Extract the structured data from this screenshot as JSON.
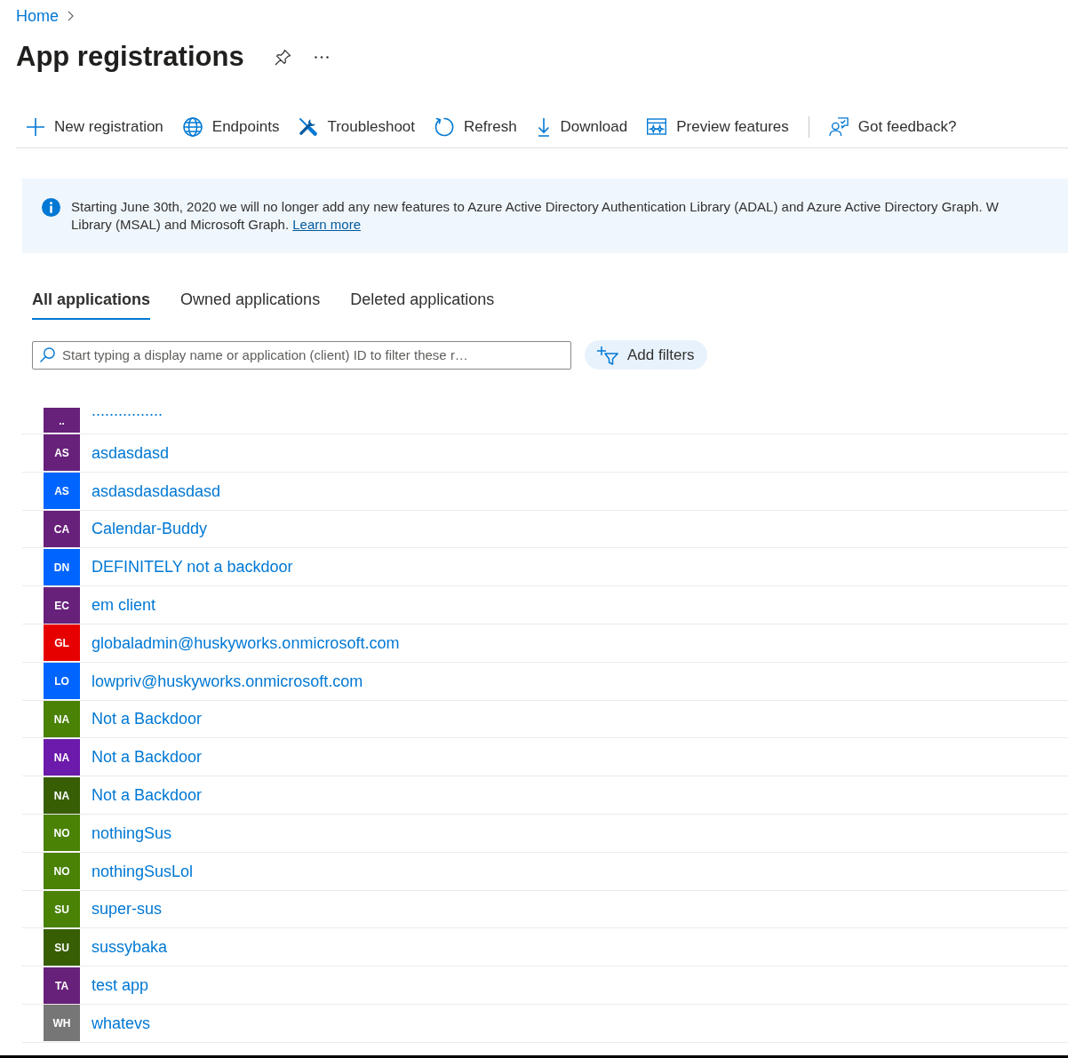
{
  "breadcrumb": [
    {
      "label": "Home"
    }
  ],
  "header": {
    "title": "App registrations"
  },
  "toolbar": [
    {
      "kind": "new",
      "label": "New registration"
    },
    {
      "kind": "endpoints",
      "label": "Endpoints"
    },
    {
      "kind": "troubleshoot",
      "label": "Troubleshoot"
    },
    {
      "kind": "refresh",
      "label": "Refresh"
    },
    {
      "kind": "download",
      "label": "Download"
    },
    {
      "kind": "preview",
      "label": "Preview features"
    },
    {
      "kind": "separator"
    },
    {
      "kind": "feedback",
      "label": "Got feedback?"
    }
  ],
  "banner": {
    "text_lines": [
      "Starting June 30th, 2020 we will no longer add any new features to Azure Active Directory Authentication Library (ADAL) and Azure Active Directory Graph. W",
      "Library (MSAL) and Microsoft Graph."
    ],
    "link": "Learn more"
  },
  "tabs": [
    {
      "label": "All applications",
      "selected": true
    },
    {
      "label": "Owned applications",
      "selected": false
    },
    {
      "label": "Deleted applications",
      "selected": false
    }
  ],
  "search": {
    "placeholder": "Start typing a display name or application (client) ID to filter these r…"
  },
  "filter_button": {
    "label": "Add filters"
  },
  "applications": [
    {
      "initials": "..",
      "name": "................",
      "color": "#68217a"
    },
    {
      "initials": "AS",
      "name": "asdasdasd",
      "color": "#68217a"
    },
    {
      "initials": "AS",
      "name": "asdasdasdasdasd",
      "color": "#0065ff"
    },
    {
      "initials": "CA",
      "name": "Calendar-Buddy",
      "color": "#68217a"
    },
    {
      "initials": "DN",
      "name": "DEFINITELY not a backdoor",
      "color": "#0065ff"
    },
    {
      "initials": "EC",
      "name": "em client",
      "color": "#68217a"
    },
    {
      "initials": "GL",
      "name": "globaladmin@huskyworks.onmicrosoft.com",
      "color": "#e60000"
    },
    {
      "initials": "LO",
      "name": "lowpriv@huskyworks.onmicrosoft.com",
      "color": "#0065ff"
    },
    {
      "initials": "NA",
      "name": "Not a Backdoor",
      "color": "#498205"
    },
    {
      "initials": "NA",
      "name": "Not a Backdoor",
      "color": "#6b1aab"
    },
    {
      "initials": "NA",
      "name": "Not a Backdoor",
      "color": "#385e04"
    },
    {
      "initials": "NO",
      "name": "nothingSus",
      "color": "#498205"
    },
    {
      "initials": "NO",
      "name": "nothingSusLol",
      "color": "#498205"
    },
    {
      "initials": "SU",
      "name": "super-sus",
      "color": "#498205"
    },
    {
      "initials": "SU",
      "name": "sussybaka",
      "color": "#385e04"
    },
    {
      "initials": "TA",
      "name": "test app",
      "color": "#68217a"
    },
    {
      "initials": "WH",
      "name": "whatevs",
      "color": "#767676"
    }
  ]
}
